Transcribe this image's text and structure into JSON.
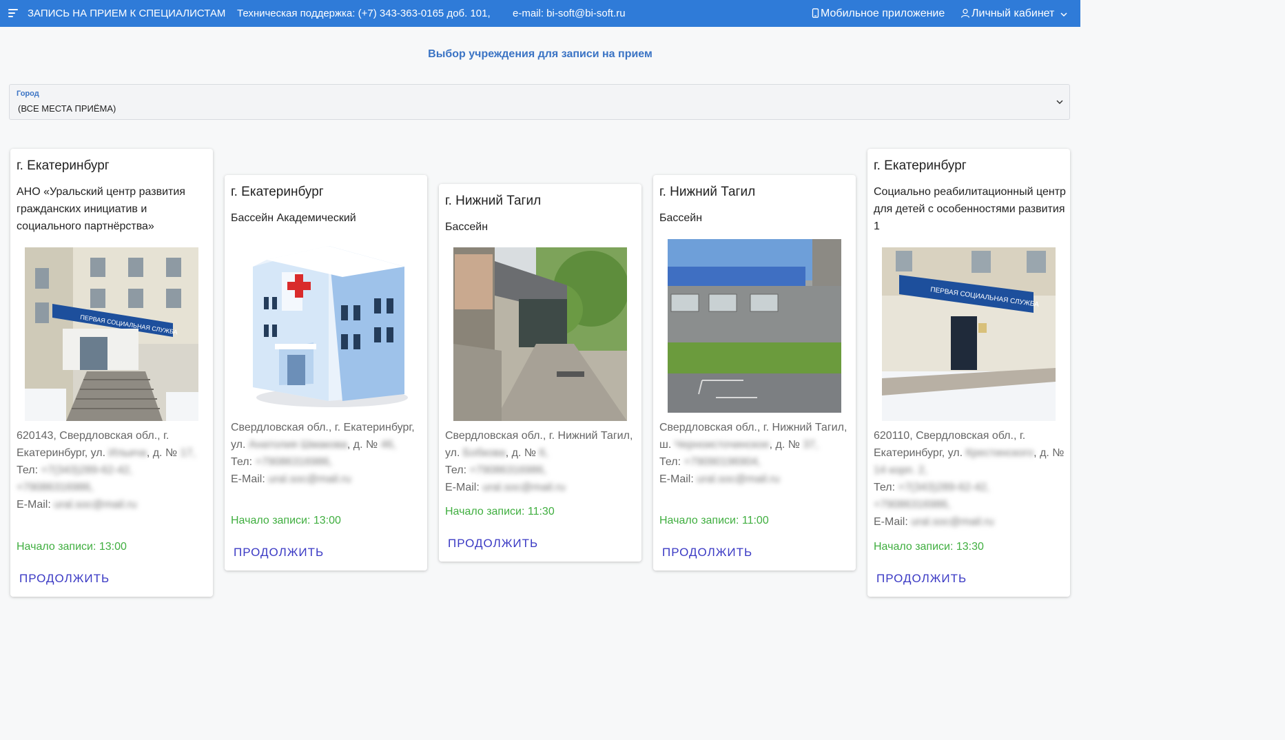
{
  "header": {
    "title": "ЗАПИСЬ НА ПРИЕМ К СПЕЦИАЛИСТАМ",
    "support": "Техническая поддержка: (+7) 343-363-0165 доб. 101,",
    "email": "e-mail: bi-soft@bi-soft.ru",
    "mobile_app": "Мобильное приложение",
    "cabinet": "Личный кабинет",
    "bar_color": "#2f7bd8"
  },
  "page_title": "Выбор учреждения для записи на прием",
  "city_filter": {
    "label": "Город",
    "value": "(ВСЕ МЕСТА ПРИЁМА)"
  },
  "cards": [
    {
      "city": "г. Екатеринбург",
      "name": "АНО «Уральский центр развития гражданских инициатив и социального партнёрства»",
      "image": "office-photo",
      "address_prefix": "620143, Свердловская обл., г. Екатеринбург, ул.",
      "street": "Ильича",
      "house_label": ", д. №",
      "house": "17,",
      "phone_label": "Тел:",
      "phones": "+7(343)289-62-42, +79086316986,",
      "email_label": "E-Mail:",
      "email": "ural.soc@mail.ru",
      "start": "Начало записи: 13:00",
      "action": "ПРОДОЛЖИТЬ"
    },
    {
      "city": "г. Екатеринбург",
      "name": "Бассейн Академический",
      "image": "building-icon",
      "address_prefix": "Свердловская обл., г. Екатеринбург, ул.",
      "street": "Анатолия Шмакова",
      "house_label": ", д. №",
      "house": "46,",
      "phone_label": "Тел:",
      "phones": "+79086316986,",
      "email_label": "E-Mail:",
      "email": "ural.soc@mail.ru",
      "start": "Начало записи: 13:00",
      "action": "ПРОДОЛЖИТЬ"
    },
    {
      "city": "г. Нижний Тагил",
      "name": "Бассейн",
      "image": "entrance-photo",
      "address_prefix": "Свердловская обл., г. Нижний Тагил, ул.",
      "street": "Бобкова",
      "house_label": ", д. №",
      "house": "6,",
      "phone_label": "Тел:",
      "phones": "+79086316986,",
      "email_label": "E-Mail:",
      "email": "ural.soc@mail.ru",
      "start": "Начало записи: 11:30",
      "action": "ПРОДОЛЖИТЬ"
    },
    {
      "city": "г. Нижний Тагил",
      "name": "Бассейн",
      "image": "pool-building-photo",
      "address_prefix": "Свердловская обл., г. Нижний Тагил, ш.",
      "street": "Черноисточинское",
      "house_label": ", д. №",
      "house": "37,",
      "phone_label": "Тел:",
      "phones": "+79090196904,",
      "email_label": "E-Mail:",
      "email": "ural.soc@mail.ru",
      "start": "Начало записи: 11:00",
      "action": "ПРОДОЛЖИТЬ"
    },
    {
      "city": "г. Екатеринбург",
      "name": "Социально реабилитационный центр для детей с особенностями развития 1",
      "image": "center-photo",
      "address_prefix": "620110, Свердловская обл., г. Екатеринбург, ул.",
      "street": "Крестинского",
      "house_label": ", д. №",
      "house": "14 корп. 2,",
      "phone_label": "Тел:",
      "phones": "+7(343)289-62-42, +79086316986,",
      "email_label": "E-Mail:",
      "email": "ural.soc@mail.ru",
      "start": "Начало записи: 13:30",
      "action": "ПРОДОЛЖИТЬ"
    }
  ],
  "sign_text": "ПЕРВАЯ СОЦИАЛЬНАЯ СЛУЖБА"
}
